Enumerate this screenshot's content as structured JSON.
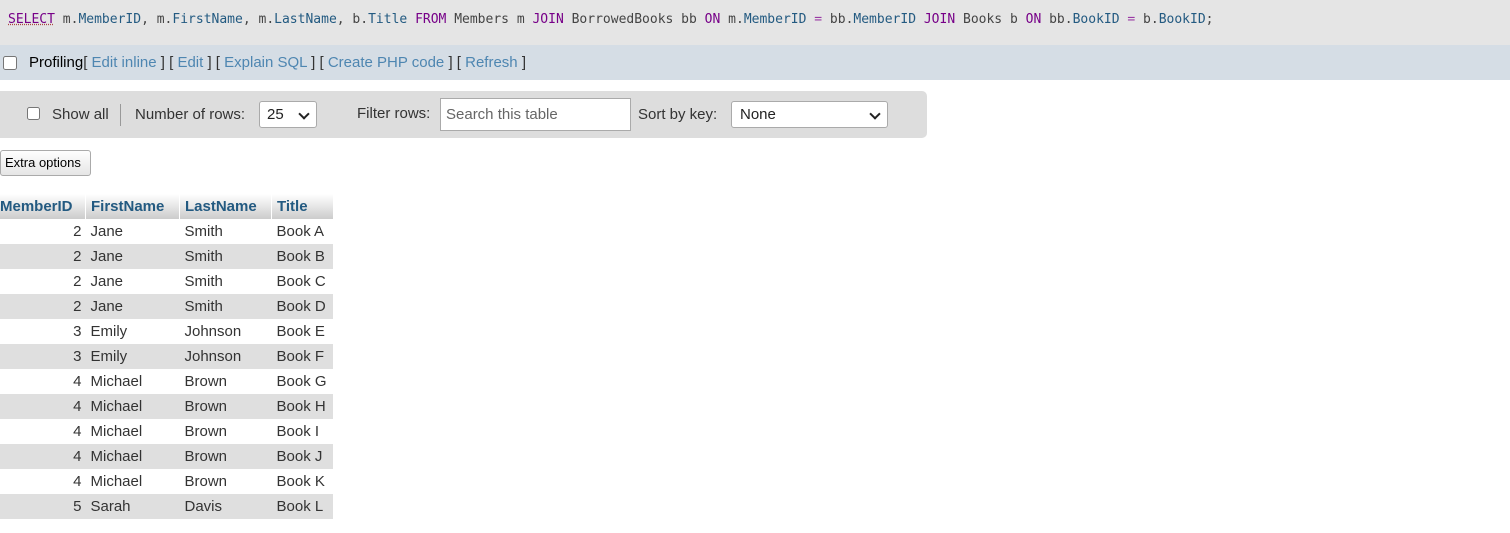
{
  "sql": {
    "tokens": [
      {
        "t": "SELECT",
        "c": "kw first"
      },
      {
        "t": " m.",
        "c": ""
      },
      {
        "t": "MemberID",
        "c": "col"
      },
      {
        "t": ", m.",
        "c": ""
      },
      {
        "t": "FirstName",
        "c": "col"
      },
      {
        "t": ", m.",
        "c": ""
      },
      {
        "t": "LastName",
        "c": "col"
      },
      {
        "t": ", b.",
        "c": ""
      },
      {
        "t": "Title",
        "c": "col"
      },
      {
        "t": " ",
        "c": ""
      },
      {
        "t": "FROM",
        "c": "kw"
      },
      {
        "t": " Members m ",
        "c": ""
      },
      {
        "t": "JOIN",
        "c": "kw"
      },
      {
        "t": " BorrowedBooks bb ",
        "c": ""
      },
      {
        "t": "ON",
        "c": "kw"
      },
      {
        "t": " m.",
        "c": ""
      },
      {
        "t": "MemberID",
        "c": "col"
      },
      {
        "t": " ",
        "c": ""
      },
      {
        "t": "=",
        "c": "op"
      },
      {
        "t": " bb.",
        "c": ""
      },
      {
        "t": "MemberID",
        "c": "col"
      },
      {
        "t": " ",
        "c": ""
      },
      {
        "t": "JOIN",
        "c": "kw"
      },
      {
        "t": " Books b ",
        "c": ""
      },
      {
        "t": "ON",
        "c": "kw"
      },
      {
        "t": " bb.",
        "c": ""
      },
      {
        "t": "BookID",
        "c": "col"
      },
      {
        "t": " ",
        "c": ""
      },
      {
        "t": "=",
        "c": "op"
      },
      {
        "t": " b.",
        "c": ""
      },
      {
        "t": "BookID",
        "c": "col"
      },
      {
        "t": ";",
        "c": ""
      }
    ]
  },
  "profiling": {
    "label": "Profiling",
    "links": [
      {
        "name": "edit-inline-link",
        "label": "Edit inline"
      },
      {
        "name": "edit-link",
        "label": "Edit"
      },
      {
        "name": "explain-sql-link",
        "label": "Explain SQL"
      },
      {
        "name": "create-php-code-link",
        "label": "Create PHP code"
      },
      {
        "name": "refresh-link",
        "label": "Refresh"
      }
    ]
  },
  "navigation": {
    "show_all_label": "Show all",
    "rows_label": "Number of rows:",
    "rows_value": "25",
    "filter_label": "Filter rows:",
    "filter_placeholder": "Search this table",
    "sort_label": "Sort by key:",
    "sort_value": "None"
  },
  "extra_options_label": "Extra options",
  "table": {
    "columns": [
      "MemberID",
      "FirstName",
      "LastName",
      "Title"
    ],
    "rows": [
      [
        "2",
        "Jane",
        "Smith",
        "Book A"
      ],
      [
        "2",
        "Jane",
        "Smith",
        "Book B"
      ],
      [
        "2",
        "Jane",
        "Smith",
        "Book C"
      ],
      [
        "2",
        "Jane",
        "Smith",
        "Book D"
      ],
      [
        "3",
        "Emily",
        "Johnson",
        "Book E"
      ],
      [
        "3",
        "Emily",
        "Johnson",
        "Book F"
      ],
      [
        "4",
        "Michael",
        "Brown",
        "Book G"
      ],
      [
        "4",
        "Michael",
        "Brown",
        "Book H"
      ],
      [
        "4",
        "Michael",
        "Brown",
        "Book I"
      ],
      [
        "4",
        "Michael",
        "Brown",
        "Book J"
      ],
      [
        "4",
        "Michael",
        "Brown",
        "Book K"
      ],
      [
        "5",
        "Sarah",
        "Davis",
        "Book L"
      ]
    ]
  },
  "colors": {
    "sql_keyword": "#770088",
    "sql_column": "#235a81",
    "link": "#4e86b1",
    "header_text": "#235a81",
    "row_stripe": "#dfdfdf"
  }
}
